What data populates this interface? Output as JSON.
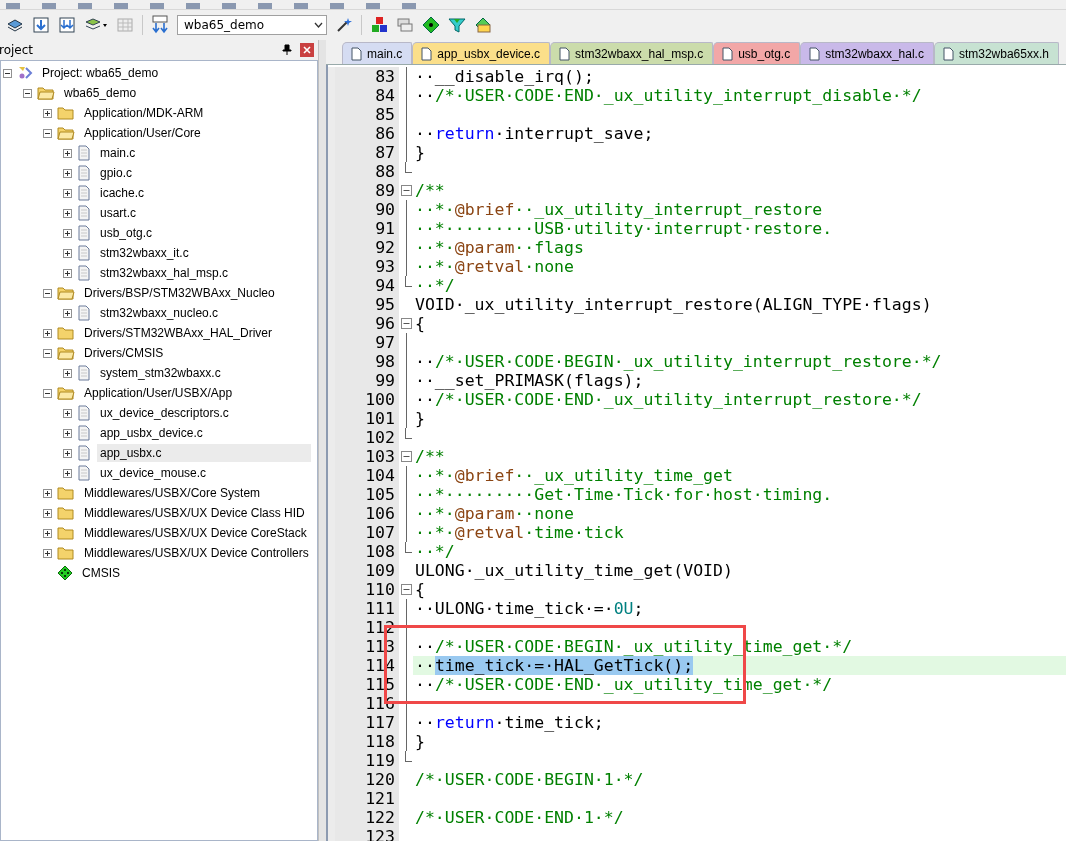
{
  "toolbar": {
    "target_select": {
      "value": "wba65_demo"
    }
  },
  "project_panel": {
    "title": "roject",
    "tree": [
      {
        "label": "Project: wba65_demo",
        "kind": "project",
        "expanded": true,
        "selected": false,
        "children": [
          {
            "label": "wba65_demo",
            "kind": "target",
            "expanded": true,
            "selected": false,
            "children": [
              {
                "label": "Application/MDK-ARM",
                "kind": "group",
                "expanded": false,
                "selected": false
              },
              {
                "label": "Application/User/Core",
                "kind": "group",
                "expanded": true,
                "selected": false,
                "children": [
                  {
                    "label": "main.c",
                    "kind": "file",
                    "expanded": false,
                    "selected": false
                  },
                  {
                    "label": "gpio.c",
                    "kind": "file",
                    "expanded": false,
                    "selected": false
                  },
                  {
                    "label": "icache.c",
                    "kind": "file",
                    "expanded": false,
                    "selected": false
                  },
                  {
                    "label": "usart.c",
                    "kind": "file",
                    "expanded": false,
                    "selected": false
                  },
                  {
                    "label": "usb_otg.c",
                    "kind": "file",
                    "expanded": false,
                    "selected": false
                  },
                  {
                    "label": "stm32wbaxx_it.c",
                    "kind": "file",
                    "expanded": false,
                    "selected": false
                  },
                  {
                    "label": "stm32wbaxx_hal_msp.c",
                    "kind": "file",
                    "expanded": false,
                    "selected": false
                  }
                ]
              },
              {
                "label": "Drivers/BSP/STM32WBAxx_Nucleo",
                "kind": "group",
                "expanded": true,
                "selected": false,
                "children": [
                  {
                    "label": "stm32wbaxx_nucleo.c",
                    "kind": "file",
                    "expanded": false,
                    "selected": false
                  }
                ]
              },
              {
                "label": "Drivers/STM32WBAxx_HAL_Driver",
                "kind": "group",
                "expanded": false,
                "selected": false
              },
              {
                "label": "Drivers/CMSIS",
                "kind": "group",
                "expanded": true,
                "selected": false,
                "children": [
                  {
                    "label": "system_stm32wbaxx.c",
                    "kind": "file",
                    "expanded": false,
                    "selected": false
                  }
                ]
              },
              {
                "label": "Application/User/USBX/App",
                "kind": "group",
                "expanded": true,
                "selected": false,
                "children": [
                  {
                    "label": "ux_device_descriptors.c",
                    "kind": "file",
                    "expanded": false,
                    "selected": false
                  },
                  {
                    "label": "app_usbx_device.c",
                    "kind": "file",
                    "expanded": false,
                    "selected": false
                  },
                  {
                    "label": "app_usbx.c",
                    "kind": "file",
                    "expanded": false,
                    "selected": true
                  },
                  {
                    "label": "ux_device_mouse.c",
                    "kind": "file",
                    "expanded": false,
                    "selected": false
                  }
                ]
              },
              {
                "label": "Middlewares/USBX/Core System",
                "kind": "group",
                "expanded": false,
                "selected": false
              },
              {
                "label": "Middlewares/USBX/UX Device Class HID",
                "kind": "group",
                "expanded": false,
                "selected": false
              },
              {
                "label": "Middlewares/USBX/UX Device CoreStack",
                "kind": "group",
                "expanded": false,
                "selected": false
              },
              {
                "label": "Middlewares/USBX/UX Device Controllers",
                "kind": "group",
                "expanded": false,
                "selected": false
              },
              {
                "label": "CMSIS",
                "kind": "component",
                "selected": false
              }
            ]
          }
        ]
      }
    ]
  },
  "tabs": [
    {
      "label": "main.c",
      "color": "#d5dcf2",
      "selected": false
    },
    {
      "label": "app_usbx_device.c",
      "color": "#fbdf8a",
      "selected": false
    },
    {
      "label": "stm32wbaxx_hal_msp.c",
      "color": "#cbdcab",
      "selected": false
    },
    {
      "label": "usb_otg.c",
      "color": "#f2a7a7",
      "selected": false
    },
    {
      "label": "stm32wbaxx_hal.c",
      "color": "#c9b9e9",
      "selected": false
    },
    {
      "label": "stm32wba65xx.h",
      "color": "#c7e2d2",
      "selected": false
    }
  ],
  "editor": {
    "lines": [
      {
        "number": "83",
        "kind": "fold-body",
        "current": false,
        "segments": [
          {
            "kind": "plain",
            "t": "··__disable_irq();"
          }
        ]
      },
      {
        "number": "84",
        "kind": "fold-body",
        "current": false,
        "segments": [
          {
            "kind": "plain",
            "t": "··"
          },
          {
            "kind": "comment",
            "t": "/*·USER·CODE·END·_ux_utility_interrupt_disable·*/"
          }
        ]
      },
      {
        "number": "85",
        "kind": "fold-body",
        "current": false
      },
      {
        "number": "86",
        "kind": "fold-body",
        "current": false,
        "segments": [
          {
            "kind": "plain",
            "t": "··"
          },
          {
            "kind": "keyword",
            "t": "return"
          },
          {
            "kind": "plain",
            "t": "·interrupt_save;"
          }
        ]
      },
      {
        "number": "87",
        "kind": "fold-body",
        "current": false,
        "segments": [
          {
            "kind": "plain",
            "t": "}"
          }
        ]
      },
      {
        "number": "88",
        "kind": "fold-end",
        "current": false
      },
      {
        "number": "89",
        "kind": "fold-start",
        "current": false,
        "segments": [
          {
            "kind": "comment",
            "t": "/**"
          }
        ]
      },
      {
        "number": "90",
        "kind": "fold-body",
        "current": false,
        "segments": [
          {
            "kind": "comment",
            "t": "··*·"
          },
          {
            "kind": "tag",
            "t": "@brief"
          },
          {
            "kind": "comment",
            "t": "··_ux_utility_interrupt_restore"
          }
        ]
      },
      {
        "number": "91",
        "kind": "fold-body",
        "current": false,
        "segments": [
          {
            "kind": "comment",
            "t": "··*·········USB·utility·interrupt·restore."
          }
        ]
      },
      {
        "number": "92",
        "kind": "fold-body",
        "current": false,
        "segments": [
          {
            "kind": "comment",
            "t": "··*·"
          },
          {
            "kind": "tag",
            "t": "@param"
          },
          {
            "kind": "comment",
            "t": "··flags"
          }
        ]
      },
      {
        "number": "93",
        "kind": "fold-body",
        "current": false,
        "segments": [
          {
            "kind": "comment",
            "t": "··*·"
          },
          {
            "kind": "tag",
            "t": "@retval"
          },
          {
            "kind": "comment",
            "t": "·none"
          }
        ]
      },
      {
        "number": "94",
        "kind": "fold-end",
        "current": false,
        "segments": [
          {
            "kind": "comment",
            "t": "··*/"
          }
        ]
      },
      {
        "number": "95",
        "kind": "unfolded",
        "current": false,
        "segments": [
          {
            "kind": "plain",
            "t": "VOID·_ux_utility_interrupt_restore(ALIGN_TYPE·flags)"
          }
        ]
      },
      {
        "number": "96",
        "kind": "fold-start",
        "current": false,
        "segments": [
          {
            "kind": "plain",
            "t": "{"
          }
        ]
      },
      {
        "number": "97",
        "kind": "fold-body",
        "current": false
      },
      {
        "number": "98",
        "kind": "fold-body",
        "current": false,
        "segments": [
          {
            "kind": "plain",
            "t": "··"
          },
          {
            "kind": "comment",
            "t": "/*·USER·CODE·BEGIN·_ux_utility_interrupt_restore·*/"
          }
        ]
      },
      {
        "number": "99",
        "kind": "fold-body",
        "current": false,
        "segments": [
          {
            "kind": "plain",
            "t": "··__set_PRIMASK(flags);"
          }
        ]
      },
      {
        "number": "100",
        "kind": "fold-body",
        "current": false,
        "segments": [
          {
            "kind": "plain",
            "t": "··"
          },
          {
            "kind": "comment",
            "t": "/*·USER·CODE·END·_ux_utility_interrupt_restore·*/"
          }
        ]
      },
      {
        "number": "101",
        "kind": "fold-body",
        "current": false,
        "segments": [
          {
            "kind": "plain",
            "t": "}"
          }
        ]
      },
      {
        "number": "102",
        "kind": "fold-end",
        "current": false
      },
      {
        "number": "103",
        "kind": "fold-start",
        "current": false,
        "segments": [
          {
            "kind": "comment",
            "t": "/**"
          }
        ]
      },
      {
        "number": "104",
        "kind": "fold-body",
        "current": false,
        "segments": [
          {
            "kind": "comment",
            "t": "··*·"
          },
          {
            "kind": "tag",
            "t": "@brief"
          },
          {
            "kind": "comment",
            "t": "··_ux_utility_time_get"
          }
        ]
      },
      {
        "number": "105",
        "kind": "fold-body",
        "current": false,
        "segments": [
          {
            "kind": "comment",
            "t": "··*·········Get·Time·Tick·for·host·timing."
          }
        ]
      },
      {
        "number": "106",
        "kind": "fold-body",
        "current": false,
        "segments": [
          {
            "kind": "comment",
            "t": "··*·"
          },
          {
            "kind": "tag",
            "t": "@param"
          },
          {
            "kind": "comment",
            "t": "··none"
          }
        ]
      },
      {
        "number": "107",
        "kind": "fold-body",
        "current": false,
        "segments": [
          {
            "kind": "comment",
            "t": "··*·"
          },
          {
            "kind": "tag",
            "t": "@retval"
          },
          {
            "kind": "comment",
            "t": "·time·tick"
          }
        ]
      },
      {
        "number": "108",
        "kind": "fold-end",
        "current": false,
        "segments": [
          {
            "kind": "comment",
            "t": "··*/"
          }
        ]
      },
      {
        "number": "109",
        "kind": "unfolded",
        "current": false,
        "segments": [
          {
            "kind": "plain",
            "t": "ULONG·_ux_utility_time_get(VOID)"
          }
        ]
      },
      {
        "number": "110",
        "kind": "fold-start",
        "current": false,
        "segments": [
          {
            "kind": "plain",
            "t": "{"
          }
        ]
      },
      {
        "number": "111",
        "kind": "fold-body",
        "current": false,
        "segments": [
          {
            "kind": "plain",
            "t": "··ULONG·time_tick·=·"
          },
          {
            "kind": "number",
            "t": "0U"
          },
          {
            "kind": "plain",
            "t": ";"
          }
        ]
      },
      {
        "number": "112",
        "kind": "fold-body",
        "current": false
      },
      {
        "number": "113",
        "kind": "fold-body",
        "current": false,
        "segments": [
          {
            "kind": "plain",
            "t": "··"
          },
          {
            "kind": "comment",
            "t": "/*·USER·CODE·BEGIN·_ux_utility_time_get·*/"
          }
        ]
      },
      {
        "number": "114",
        "kind": "fold-body",
        "current": true,
        "segments": [
          {
            "kind": "plain",
            "t": "··"
          },
          {
            "kind": "selection",
            "t": "time_tick·=·HAL_GetTick();"
          }
        ]
      },
      {
        "number": "115",
        "kind": "fold-body",
        "current": false,
        "segments": [
          {
            "kind": "plain",
            "t": "··"
          },
          {
            "kind": "comment",
            "t": "/*·USER·CODE·END·_ux_utility_time_get·*/"
          }
        ]
      },
      {
        "number": "116",
        "kind": "fold-body",
        "current": false
      },
      {
        "number": "117",
        "kind": "fold-body",
        "current": false,
        "segments": [
          {
            "kind": "plain",
            "t": "··"
          },
          {
            "kind": "keyword",
            "t": "return"
          },
          {
            "kind": "plain",
            "t": "·time_tick;"
          }
        ]
      },
      {
        "number": "118",
        "kind": "fold-body",
        "current": false,
        "segments": [
          {
            "kind": "plain",
            "t": "}"
          }
        ]
      },
      {
        "number": "119",
        "kind": "fold-end",
        "current": false
      },
      {
        "number": "120",
        "kind": "unfolded",
        "current": false,
        "segments": [
          {
            "kind": "comment",
            "t": "/*·USER·CODE·BEGIN·1·*/"
          }
        ]
      },
      {
        "number": "121",
        "kind": "unfolded",
        "current": false
      },
      {
        "number": "122",
        "kind": "unfolded",
        "current": false,
        "segments": [
          {
            "kind": "comment",
            "t": "/*·USER·CODE·END·1·*/"
          }
        ]
      },
      {
        "number": "123",
        "kind": "unfolded",
        "current": false
      }
    ]
  }
}
